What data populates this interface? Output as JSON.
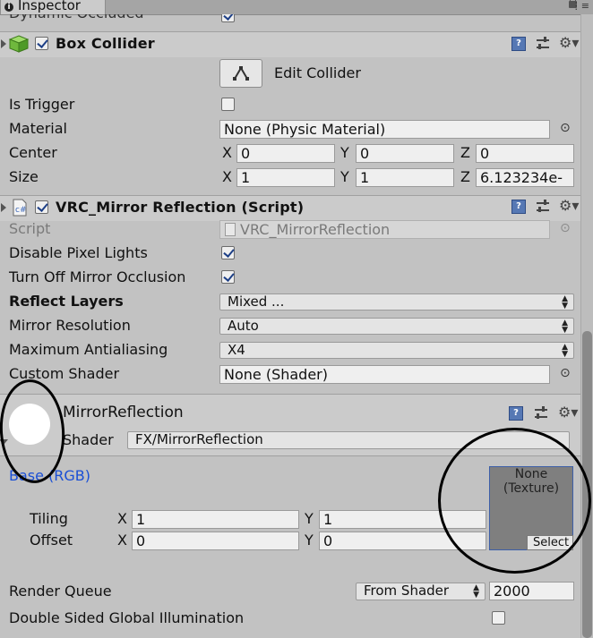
{
  "inspector": {
    "tab_title": "Inspector",
    "clipped_row": "Dynamic Occluded"
  },
  "box_collider": {
    "title": "Box Collider",
    "edit_collider_label": "Edit Collider",
    "is_trigger_label": "Is Trigger",
    "is_trigger": false,
    "material_label": "Material",
    "material_value": "None (Physic Material)",
    "center_label": "Center",
    "center": {
      "x": "0",
      "y": "0",
      "z": "0"
    },
    "size_label": "Size",
    "size": {
      "x": "1",
      "y": "1",
      "z": "6.123234e-"
    },
    "axis_x": "X",
    "axis_y": "Y",
    "axis_z": "Z"
  },
  "mirror_script": {
    "title": "VRC_Mirror Reflection (Script)",
    "script_label": "Script",
    "script_value": "VRC_MirrorReflection",
    "disable_pixel_lights_label": "Disable Pixel Lights",
    "disable_pixel_lights": true,
    "turn_off_occlusion_label": "Turn Off Mirror Occlusion",
    "turn_off_occlusion": true,
    "reflect_layers_label": "Reflect Layers",
    "reflect_layers_value": "Mixed ...",
    "mirror_resolution_label": "Mirror Resolution",
    "mirror_resolution_value": "Auto",
    "max_antialiasing_label": "Maximum Antialiasing",
    "max_antialiasing_value": "X4",
    "custom_shader_label": "Custom Shader",
    "custom_shader_value": "None (Shader)"
  },
  "material": {
    "name": "MirrorReflection",
    "shader_label": "Shader",
    "shader_value": "FX/MirrorReflection",
    "base_label": "Base (RGB)",
    "texture_none_line1": "None",
    "texture_none_line2": "(Texture)",
    "texture_select_label": "Select",
    "tiling_label": "Tiling",
    "tiling": {
      "x": "1",
      "y": "1"
    },
    "offset_label": "Offset",
    "offset": {
      "x": "0",
      "y": "0"
    },
    "render_queue_label": "Render Queue",
    "render_queue_mode": "From Shader",
    "render_queue_value": "2000",
    "double_sided_gi_label": "Double Sided Global Illumination",
    "double_sided_gi": false
  },
  "colors": {
    "panel_bg": "#c2c2c2",
    "header_bg": "#cbcbcb",
    "field_bg": "#efefef",
    "link_blue": "#1a4fd6",
    "annotation_ring": "#000000"
  },
  "icons": [
    "info-icon",
    "lock-icon",
    "menu-icon",
    "fold-arrow-icon",
    "cube-icon",
    "script-icon",
    "help-icon",
    "presets-icon",
    "gear-icon",
    "edit-collider-icon",
    "object-picker-icon",
    "dropdown-arrow-icon"
  ]
}
